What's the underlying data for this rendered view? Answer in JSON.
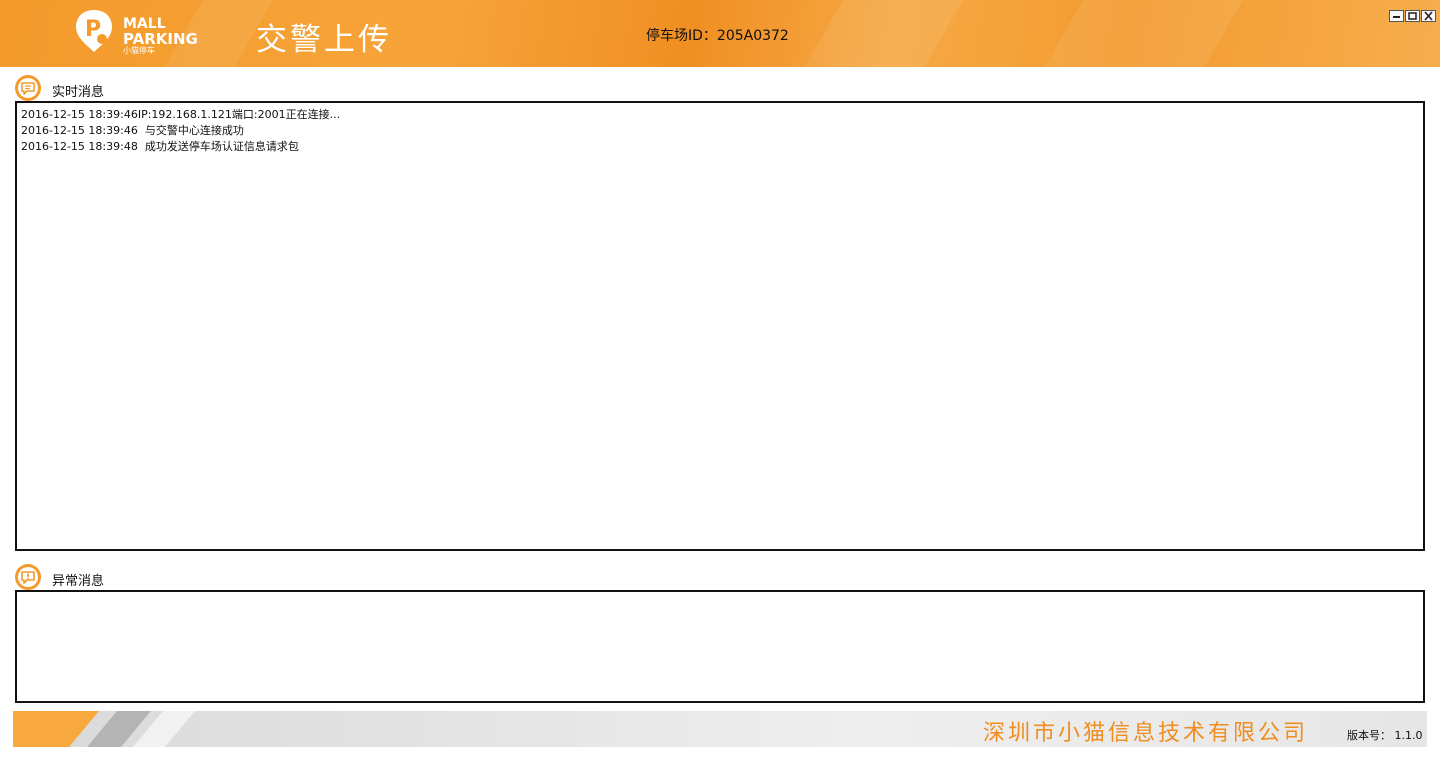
{
  "header": {
    "logo": {
      "line1": "MALL",
      "line2": "PARKING",
      "sub": "小猫停车"
    },
    "title": "交警上传",
    "parking_id_label": "停车场ID：205A0372"
  },
  "window_controls": {
    "minimize_icon": "minimize-icon",
    "maximize_icon": "maximize-icon",
    "close_icon": "close-icon"
  },
  "realtime": {
    "title": "实时消息",
    "icon": "message-icon",
    "lines": [
      "2016-12-15 18:39:46IP:192.168.1.121端口:2001正在连接...",
      "2016-12-15 18:39:46  与交警中心连接成功",
      "2016-12-15 18:39:48  成功发送停车场认证信息请求包"
    ]
  },
  "exception": {
    "title": "异常消息",
    "icon": "alert-message-icon",
    "lines": []
  },
  "footer": {
    "company": "深圳市小猫信息技术有限公司",
    "version": "版本号： 1.1.0"
  },
  "colors": {
    "brand_orange": "#f39a2a",
    "company_text": "#f08d1e"
  }
}
